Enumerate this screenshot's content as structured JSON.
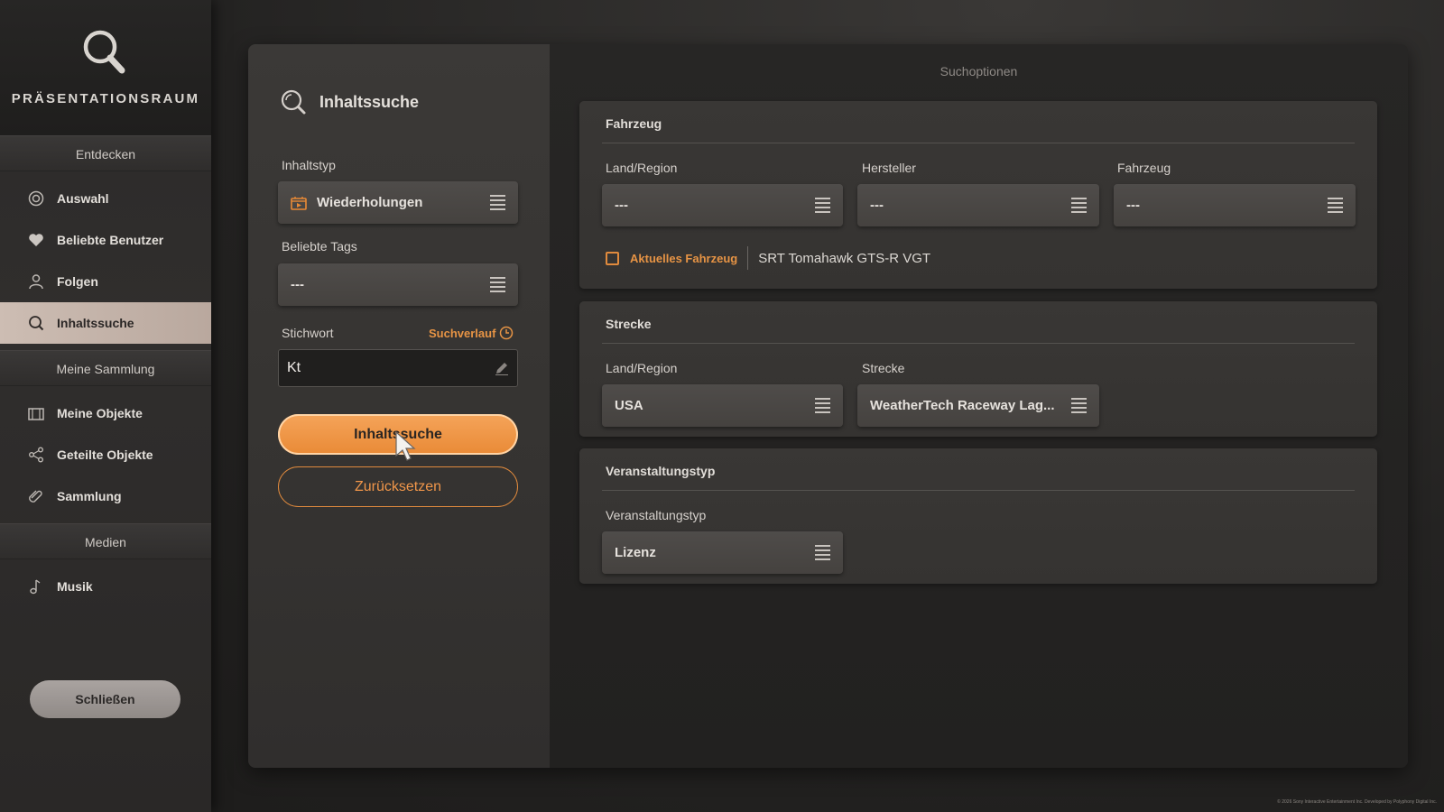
{
  "sidebar": {
    "logo_text": "PRÄSENTATIONSRAUM",
    "sections": [
      {
        "title": "Entdecken",
        "items": [
          {
            "label": "Auswahl",
            "icon": "gear-icon",
            "active": false
          },
          {
            "label": "Beliebte Benutzer",
            "icon": "heart-icon",
            "active": false
          },
          {
            "label": "Folgen",
            "icon": "user-icon",
            "active": false
          },
          {
            "label": "Inhaltssuche",
            "icon": "search-icon",
            "active": true
          }
        ]
      },
      {
        "title": "Meine Sammlung",
        "items": [
          {
            "label": "Meine Objekte",
            "icon": "folder-icon",
            "active": false
          },
          {
            "label": "Geteilte Objekte",
            "icon": "share-icon",
            "active": false
          },
          {
            "label": "Sammlung",
            "icon": "paperclip-icon",
            "active": false
          }
        ]
      },
      {
        "title": "Medien",
        "items": [
          {
            "label": "Musik",
            "icon": "music-note-icon",
            "active": false
          }
        ]
      }
    ],
    "close_label": "Schließen"
  },
  "search": {
    "title": "Inhaltssuche",
    "content_type_label": "Inhaltstyp",
    "content_type_value": "Wiederholungen",
    "tags_label": "Beliebte Tags",
    "tags_value": "---",
    "keyword_label": "Stichwort",
    "history_label": "Suchverlauf",
    "keyword_value": "Kt",
    "search_button": "Inhaltssuche",
    "reset_button": "Zurücksetzen"
  },
  "options": {
    "title": "Suchoptionen",
    "vehicle": {
      "title": "Fahrzeug",
      "country_label": "Land/Region",
      "country_value": "---",
      "maker_label": "Hersteller",
      "maker_value": "---",
      "car_label": "Fahrzeug",
      "car_value": "---",
      "current_vehicle_label": "Aktuelles Fahrzeug",
      "current_vehicle_name": "SRT Tomahawk GTS-R VGT"
    },
    "track": {
      "title": "Strecke",
      "country_label": "Land/Region",
      "country_value": "USA",
      "track_label": "Strecke",
      "track_value": "WeatherTech Raceway Lag..."
    },
    "event": {
      "title": "Veranstaltungstyp",
      "type_label": "Veranstaltungstyp",
      "type_value": "Lizenz"
    }
  },
  "footer": {
    "copyright": "© 2026 Sony Interactive Entertainment Inc. Developed by Polyphony Digital Inc."
  },
  "colors": {
    "accent": "#e98a36",
    "active_nav": "#c4b3a9"
  }
}
